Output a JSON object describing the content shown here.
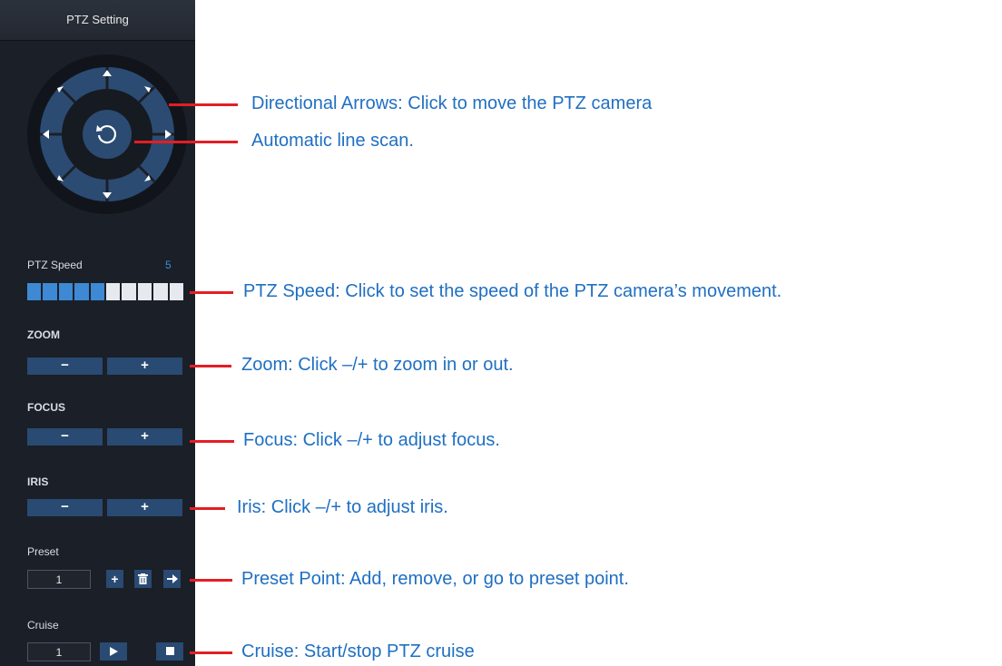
{
  "panel": {
    "title": "PTZ Setting",
    "speed_label": "PTZ Speed",
    "speed_value": "5",
    "speed_level": 5,
    "speed_max": 10,
    "zoom_label": "ZOOM",
    "focus_label": "FOCUS",
    "iris_label": "IRIS",
    "minus_symbol": "−",
    "plus_symbol": "+",
    "preset_label": "Preset",
    "preset_value": "1",
    "cruise_label": "Cruise",
    "cruise_value": "1"
  },
  "icons": {
    "up": "arrow-up-icon",
    "down": "arrow-down-icon",
    "left": "arrow-left-icon",
    "right": "arrow-right-icon",
    "center": "auto-scan-icon",
    "delete": "trash-icon",
    "goto": "arrow-right-icon",
    "play": "play-icon",
    "stop": "stop-icon"
  },
  "annotations": {
    "directional": "Directional Arrows: Click to move the PTZ camera",
    "autoscan": "Automatic line scan.",
    "speed": "PTZ Speed: Click to set the speed of the PTZ camera’s movement.",
    "zoom": "Zoom: Click –/+ to zoom in or out.",
    "focus": "Focus: Click –/+ to adjust focus.",
    "iris": "Iris: Click –/+ to adjust iris.",
    "preset": "Preset Point: Add, remove, or go to preset point.",
    "cruise": "Cruise: Start/stop PTZ cruise"
  },
  "colors": {
    "panel_bg": "#1b1f27",
    "button_blue": "#294a72",
    "speed_active": "#3d89d4",
    "leader_red": "#e31e24",
    "annotation_blue": "#1f6fc2"
  }
}
